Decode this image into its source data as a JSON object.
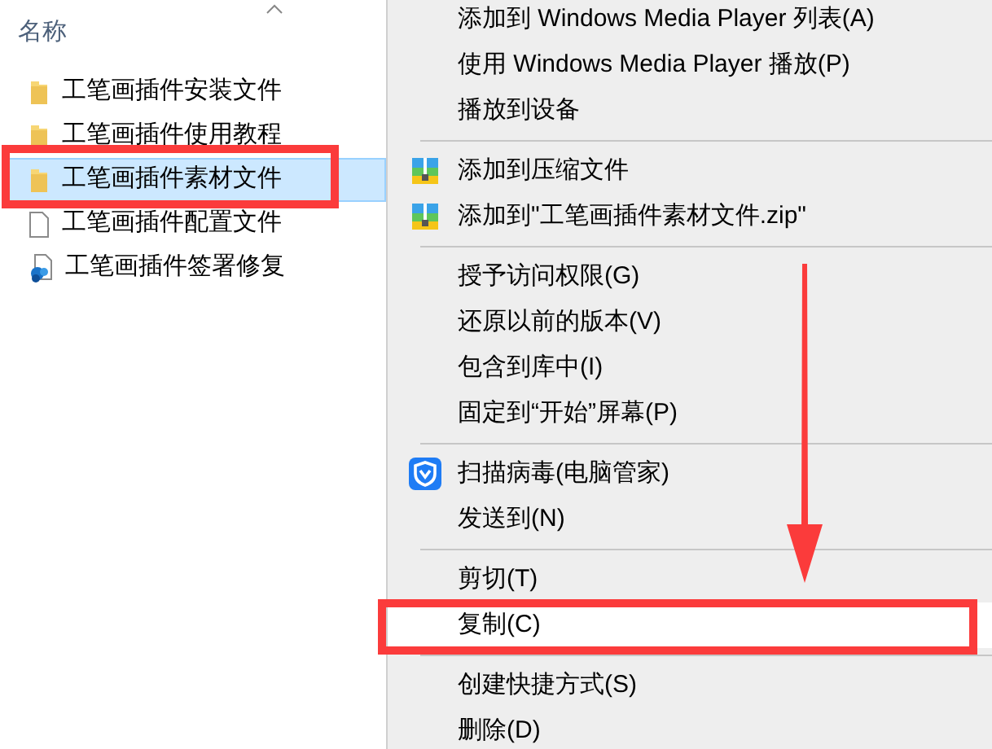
{
  "file_list": {
    "column_header": "名称",
    "files": [
      {
        "name": "工笔画插件安装文件",
        "kind": "folder",
        "selected": false
      },
      {
        "name": "工笔画插件使用教程",
        "kind": "folder",
        "selected": false
      },
      {
        "name": "工笔画插件素材文件",
        "kind": "folder",
        "selected": true
      },
      {
        "name": "工笔画插件配置文件",
        "kind": "file",
        "selected": false
      },
      {
        "name": "工笔画插件签署修复",
        "kind": "setup",
        "selected": false
      }
    ]
  },
  "context_menu": {
    "items": [
      {
        "kind": "item",
        "label": "添加到 Windows Media Player 列表(A)",
        "highlighted": false
      },
      {
        "kind": "item",
        "label": "使用 Windows Media Player 播放(P)",
        "highlighted": false
      },
      {
        "kind": "item",
        "label": "播放到设备",
        "highlighted": false
      },
      {
        "kind": "separator"
      },
      {
        "kind": "archive_item",
        "label": "添加到压缩文件",
        "highlighted": false
      },
      {
        "kind": "archive_item",
        "label": "添加到\"工笔画插件素材文件.zip\"",
        "highlighted": false
      },
      {
        "kind": "separator"
      },
      {
        "kind": "item",
        "label": "授予访问权限(G)",
        "highlighted": false
      },
      {
        "kind": "item",
        "label": "还原以前的版本(V)",
        "highlighted": false
      },
      {
        "kind": "item",
        "label": "包含到库中(I)",
        "highlighted": false
      },
      {
        "kind": "item",
        "label": "固定到“开始”屏幕(P)",
        "highlighted": false
      },
      {
        "kind": "separator"
      },
      {
        "kind": "antivirus_item",
        "label": "扫描病毒(电脑管家)",
        "highlighted": false
      },
      {
        "kind": "item",
        "label": "发送到(N)",
        "highlighted": false
      },
      {
        "kind": "separator"
      },
      {
        "kind": "item",
        "label": "剪切(T)",
        "highlighted": false
      },
      {
        "kind": "item",
        "label": "复制(C)",
        "highlighted": true
      },
      {
        "kind": "separator"
      },
      {
        "kind": "item",
        "label": "创建快捷方式(S)",
        "highlighted": false
      },
      {
        "kind": "item",
        "label": "删除(D)",
        "highlighted": false
      }
    ]
  }
}
